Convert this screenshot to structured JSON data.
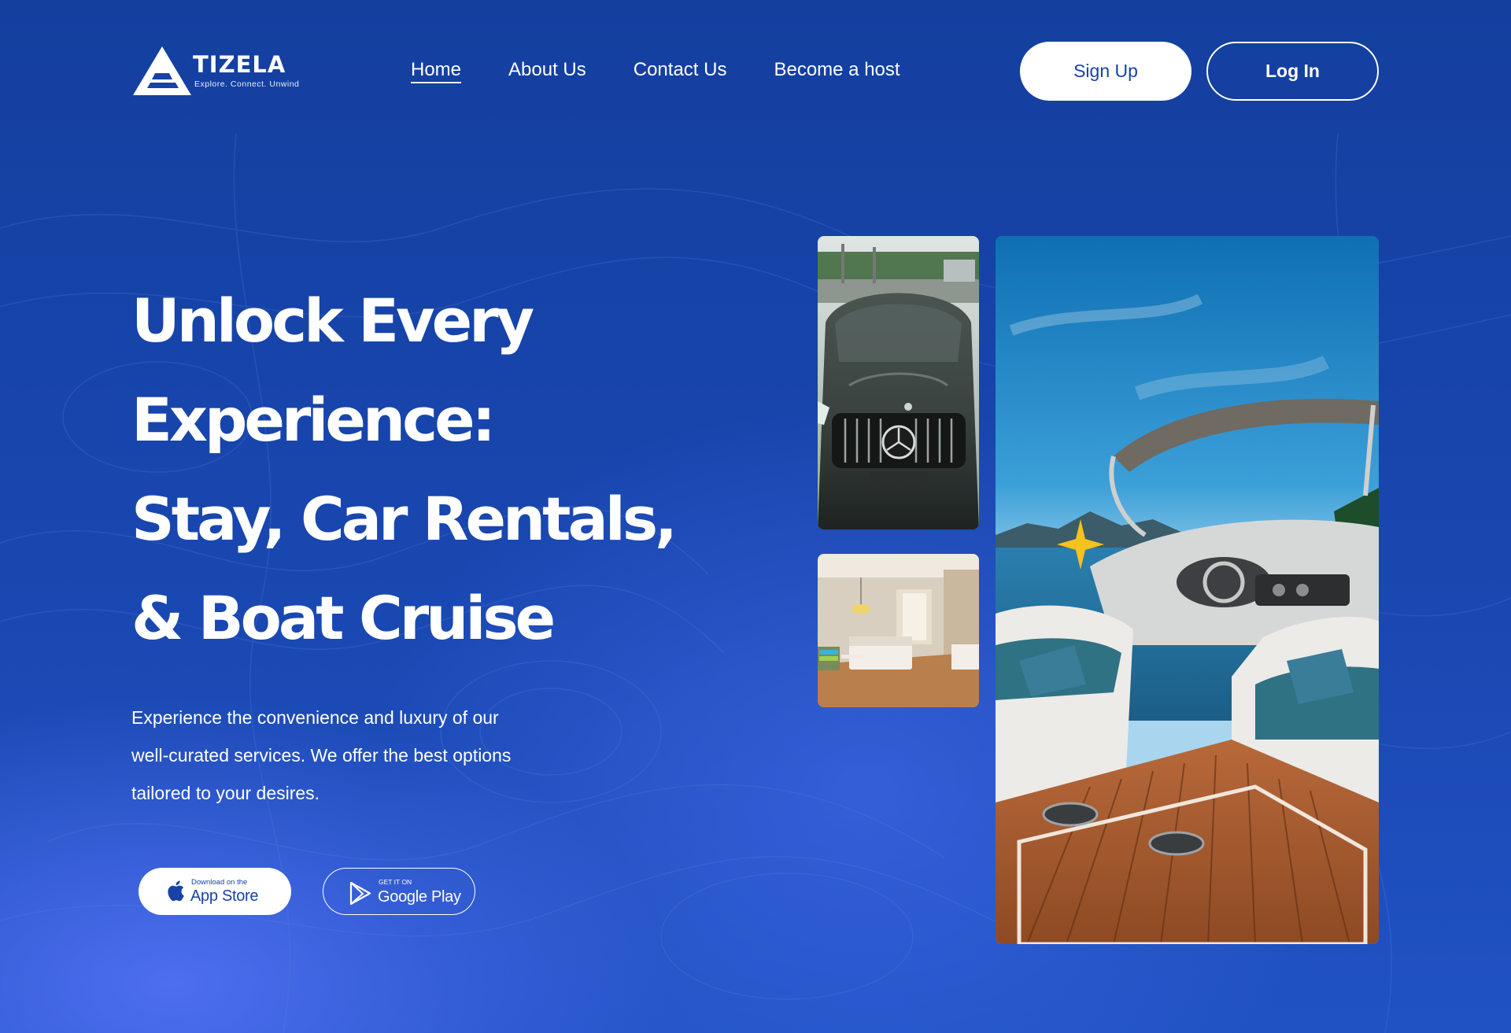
{
  "brand": {
    "name": "TIZELA",
    "tagline": "Explore. Connect. Unwind"
  },
  "nav": {
    "items": [
      {
        "label": "Home",
        "active": true
      },
      {
        "label": "About Us",
        "active": false
      },
      {
        "label": "Contact Us",
        "active": false
      },
      {
        "label": "Become a host",
        "active": false
      }
    ]
  },
  "auth": {
    "signup_label": "Sign Up",
    "login_label": "Log In"
  },
  "hero": {
    "title_lines": [
      "Unlock Every",
      "Experience:",
      "Stay, Car Rentals,",
      "& Boat Cruise"
    ],
    "subtitle_lines": [
      "Experience the convenience and luxury of our",
      "well-curated services. We offer the best options",
      "tailored to your desires."
    ]
  },
  "stores": {
    "apple": {
      "small": "Download on the",
      "big": "App Store",
      "icon": "apple-icon"
    },
    "google": {
      "small": "GET IT ON",
      "big": "Google Play",
      "icon": "google-play-icon"
    }
  },
  "gallery": {
    "images": [
      "car-photo",
      "hotel-room-photo",
      "boat-photo"
    ]
  },
  "colors": {
    "background": "#1743a6",
    "accent_star": "#f6c21c",
    "text": "#ffffff"
  }
}
